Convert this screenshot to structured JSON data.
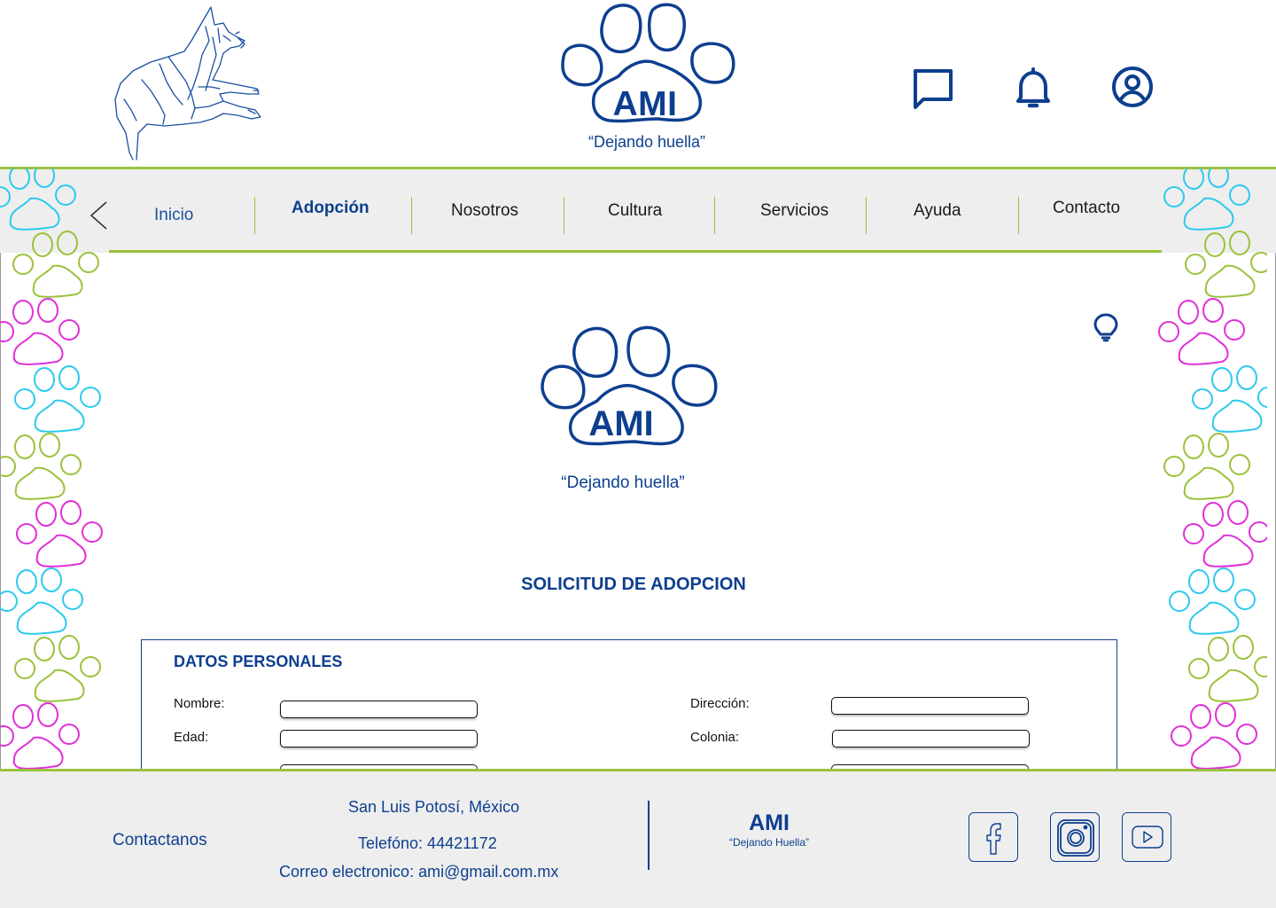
{
  "colors": {
    "primary": "#0d3f8f",
    "accent_green": "#9bc23c",
    "paw_cyan": "#2dc9ee",
    "paw_green": "#9bc23c",
    "paw_magenta": "#e030d8",
    "nav_bg": "#eeeeee"
  },
  "header": {
    "brand_name": "AMI",
    "slogan": "“Dejando huella”",
    "icons": [
      "dog-logo",
      "chat-icon",
      "bell-icon",
      "user-account-icon"
    ]
  },
  "nav": {
    "back_icon": "chevron-left-icon",
    "items": [
      {
        "label": "Inicio"
      },
      {
        "label": "Adopción",
        "active": true
      },
      {
        "label": "Nosotros"
      },
      {
        "label": "Cultura"
      },
      {
        "label": "Servicios"
      },
      {
        "label": "Ayuda"
      },
      {
        "label": "Contacto"
      }
    ]
  },
  "main": {
    "brand_name": "AMI",
    "slogan": "“Dejando huella”",
    "hint_icon": "lightbulb-icon",
    "form_title": "SOLICITUD DE ADOPCION",
    "section_title": "DATOS PERSONALES",
    "fields": [
      {
        "label": "Nombre:",
        "value": ""
      },
      {
        "label": "Dirección:",
        "value": ""
      },
      {
        "label": "Edad:",
        "value": ""
      },
      {
        "label": "Colonia:",
        "value": ""
      }
    ]
  },
  "footer": {
    "contact_label": "Contactanos",
    "city": "San Luis Potosí, México",
    "phone": "Telefóno: 44421172",
    "email": "Correo electronico: ami@gmail.com.mx",
    "brand_name": "AMI",
    "slogan": "“Dejando Huella”",
    "social_icons": [
      "facebook-icon",
      "instagram-icon",
      "youtube-icon"
    ]
  }
}
